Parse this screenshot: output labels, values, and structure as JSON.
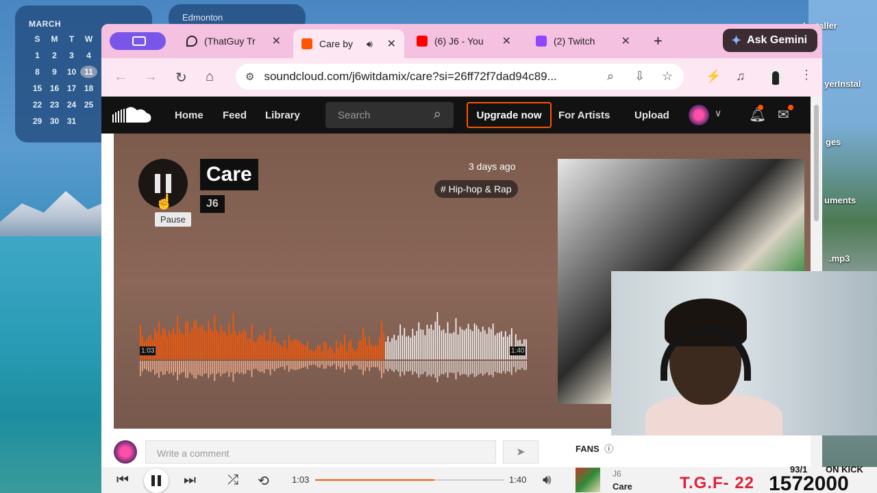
{
  "desktop": {
    "calendar": {
      "month": "MARCH",
      "weekdays": [
        "S",
        "M",
        "T",
        "W",
        "T"
      ],
      "rows": [
        [
          "1",
          "2",
          "3",
          "4"
        ],
        [
          "8",
          "9",
          "10",
          "11"
        ],
        [
          "15",
          "16",
          "17",
          "18"
        ],
        [
          "22",
          "23",
          "24",
          "25"
        ],
        [
          "29",
          "30",
          "31"
        ]
      ]
    },
    "weather": "Edmonton",
    "icons": [
      "Installer",
      "yerInstal",
      "ges",
      "uments",
      ".mp3"
    ]
  },
  "browser": {
    "tabs": [
      {
        "label": "(ThatGuy Tr"
      },
      {
        "label": "Care by"
      },
      {
        "label": "(6) J6 - You"
      },
      {
        "label": "(2) Twitch"
      }
    ],
    "gemini": "Ask Gemini",
    "url": "soundcloud.com/j6witdamix/care?si=26ff72f7dad94c89..."
  },
  "soundcloud": {
    "nav": [
      "Home",
      "Feed",
      "Library"
    ],
    "search_placeholder": "Search",
    "upgrade": "Upgrade now",
    "for_artists": "For Artists",
    "upload": "Upload",
    "track": {
      "title": "Care",
      "artist": "J6",
      "posted": "3 days ago",
      "genre": "# Hip-hop & Rap",
      "current_time": "1:03",
      "duration": "1:40",
      "progress": 0.63
    },
    "tooltip": "Pause",
    "comment_placeholder": "Write a comment",
    "fans_label": "FANS"
  },
  "player": {
    "current": "1:03",
    "duration": "1:40",
    "progress": 0.63,
    "artist": "J6",
    "title": "Care"
  },
  "overlay": {
    "red_text": "T.G.F- 22",
    "count_small": "93/1",
    "count_big": "1572000",
    "kick_text": "ON KICK"
  },
  "colors": {
    "accent": "#ff5500",
    "tabbar": "#f5c1e0"
  }
}
